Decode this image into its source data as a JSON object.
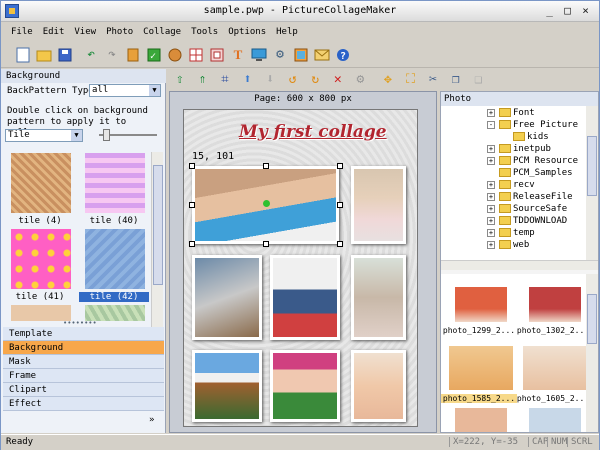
{
  "window": {
    "title": "sample.pwp - PictureCollageMaker",
    "min": "_",
    "max": "□",
    "close": "×"
  },
  "menu": [
    "File",
    "Edit",
    "View",
    "Photo",
    "Collage",
    "Tools",
    "Options",
    "Help"
  ],
  "toolbar_icons": [
    "new-icon",
    "open-icon",
    "save-icon",
    "undo-icon",
    "redo-icon",
    "book-icon",
    "check-icon",
    "shuffle-icon",
    "grid-icon",
    "frame-icon",
    "text-icon",
    "screen-icon",
    "settings-icon",
    "print-icon",
    "email-icon",
    "help-icon"
  ],
  "toolbar2_icons": [
    "move-top-icon",
    "move-up-icon",
    "crop-icon",
    "up-arrow-icon",
    "down-arrow-icon",
    "rotate-left-icon",
    "rotate-right-icon",
    "delete-icon",
    "cog-icon",
    "align-icon",
    "fit-icon",
    "cut-icon",
    "copy-icon",
    "paste-icon"
  ],
  "left": {
    "header": "Background",
    "bp_label": "BackPattern Type",
    "bp_value": "all",
    "instruction": "Double click on background pattern to apply it to collage",
    "mode": "Tile",
    "tiles": [
      {
        "label": "tile (4)",
        "color": "#d4a070"
      },
      {
        "label": "tile (40)",
        "color": "#f0a8e8"
      },
      {
        "label": "tile (41)",
        "color": "#ff66cc"
      },
      {
        "label": "tile (42)",
        "color": "#8ab0e0"
      },
      {
        "label": "",
        "color": "#e8c8a8"
      },
      {
        "label": "",
        "color": "#a8c8a0"
      }
    ],
    "categories": [
      {
        "label": "Template"
      },
      {
        "label": "Background",
        "active": true
      },
      {
        "label": "Mask"
      },
      {
        "label": "Frame"
      },
      {
        "label": "Clipart"
      },
      {
        "label": "Effect"
      }
    ]
  },
  "canvas": {
    "page_label": "Page: 600 x 800 px",
    "title": "My first collage",
    "coords": "15, 101"
  },
  "right": {
    "header": "Photo",
    "tree": [
      {
        "label": "Font",
        "indent": 0
      },
      {
        "label": "Free Picture",
        "indent": 0,
        "open": true
      },
      {
        "label": "kids",
        "indent": 1
      },
      {
        "label": "inetpub",
        "indent": 0
      },
      {
        "label": "PCM Resource",
        "indent": 0
      },
      {
        "label": "PCM_Samples",
        "indent": 0
      },
      {
        "label": "recv",
        "indent": 0
      },
      {
        "label": "ReleaseFile",
        "indent": 0
      },
      {
        "label": "SourceSafe",
        "indent": 0
      },
      {
        "label": "TDDOWNLOAD",
        "indent": 0
      },
      {
        "label": "temp",
        "indent": 0
      },
      {
        "label": "web",
        "indent": 0
      }
    ],
    "thumbs": [
      {
        "label": "photo_1299_2..."
      },
      {
        "label": "photo_1302_2..."
      },
      {
        "label": "photo_1585_2..."
      },
      {
        "label": "photo_1605_2..."
      }
    ]
  },
  "status": {
    "left": "Ready",
    "pos": "X=222, Y=-35",
    "cap": "CAP",
    "num": "NUM",
    "scrl": "SCRL"
  }
}
